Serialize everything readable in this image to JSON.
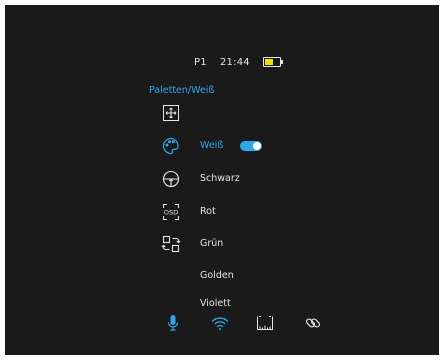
{
  "status": {
    "profile": "P1",
    "time": "21:44",
    "battery_level": 0.6
  },
  "menu": {
    "heading": "Paletten/Weiß",
    "items": [
      {
        "icon": "zoom-expand-icon",
        "label": ""
      },
      {
        "icon": "palette-icon",
        "label": "Weiß",
        "active": true,
        "toggle": "on"
      },
      {
        "icon": "crosshair-icon",
        "label": "Schwarz"
      },
      {
        "icon": "osd-icon",
        "label": "Rot"
      },
      {
        "icon": "swap-icon",
        "label": "Grün"
      },
      {
        "icon": "",
        "label": "Golden"
      },
      {
        "icon": "",
        "label": "Violett"
      }
    ]
  },
  "bottom_bar": {
    "icons": [
      "microphone-icon",
      "wifi-icon",
      "ruler-icon",
      "link-icon"
    ]
  },
  "colors": {
    "accent": "#2fa8ea",
    "background": "#1a1a1a",
    "text": "#e6e6e6",
    "battery": "#f0e000"
  }
}
